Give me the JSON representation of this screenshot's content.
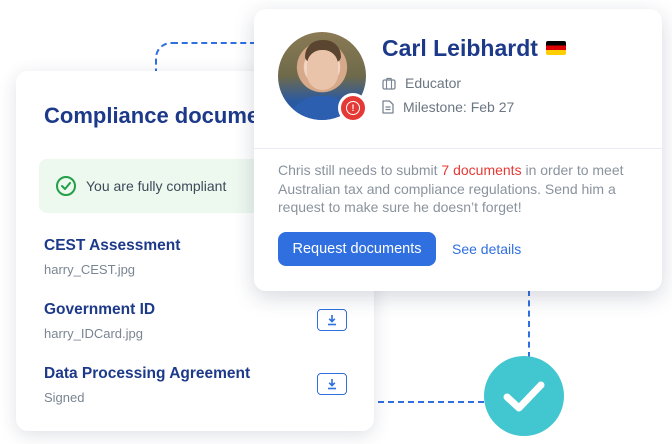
{
  "compliance_card": {
    "title": "Compliance documents",
    "status_text": "You are fully compliant",
    "documents": [
      {
        "name": "CEST Assessment",
        "file": "harry_CEST.jpg"
      },
      {
        "name": "Government ID",
        "file": "harry_IDCard.jpg"
      },
      {
        "name": "Data Processing Agreement",
        "file": "Signed"
      }
    ]
  },
  "profile_card": {
    "name": "Carl Leibhardt",
    "role": "Educator",
    "milestone": "Milestone: Feb 27",
    "message_before": "Chris still needs to submit ",
    "message_highlight": "7 documents",
    "message_after": " in order to meet Australian tax and compliance regulations. Send him a request to make sure he doesn’t forget!",
    "request_button_label": "Request documents",
    "see_details_label": "See details"
  },
  "colors": {
    "primary": "#2f6fe0",
    "heading": "#1d3a8a",
    "alert": "#e53935",
    "success": "#23a047",
    "success_badge": "#42c6cf"
  },
  "icons": {
    "flag": "germany-flag-icon",
    "role": "briefcase-icon",
    "milestone": "document-icon",
    "alert": "alert-icon",
    "compliant": "check-circle-icon",
    "download": "download-icon",
    "success": "checkmark-icon"
  }
}
